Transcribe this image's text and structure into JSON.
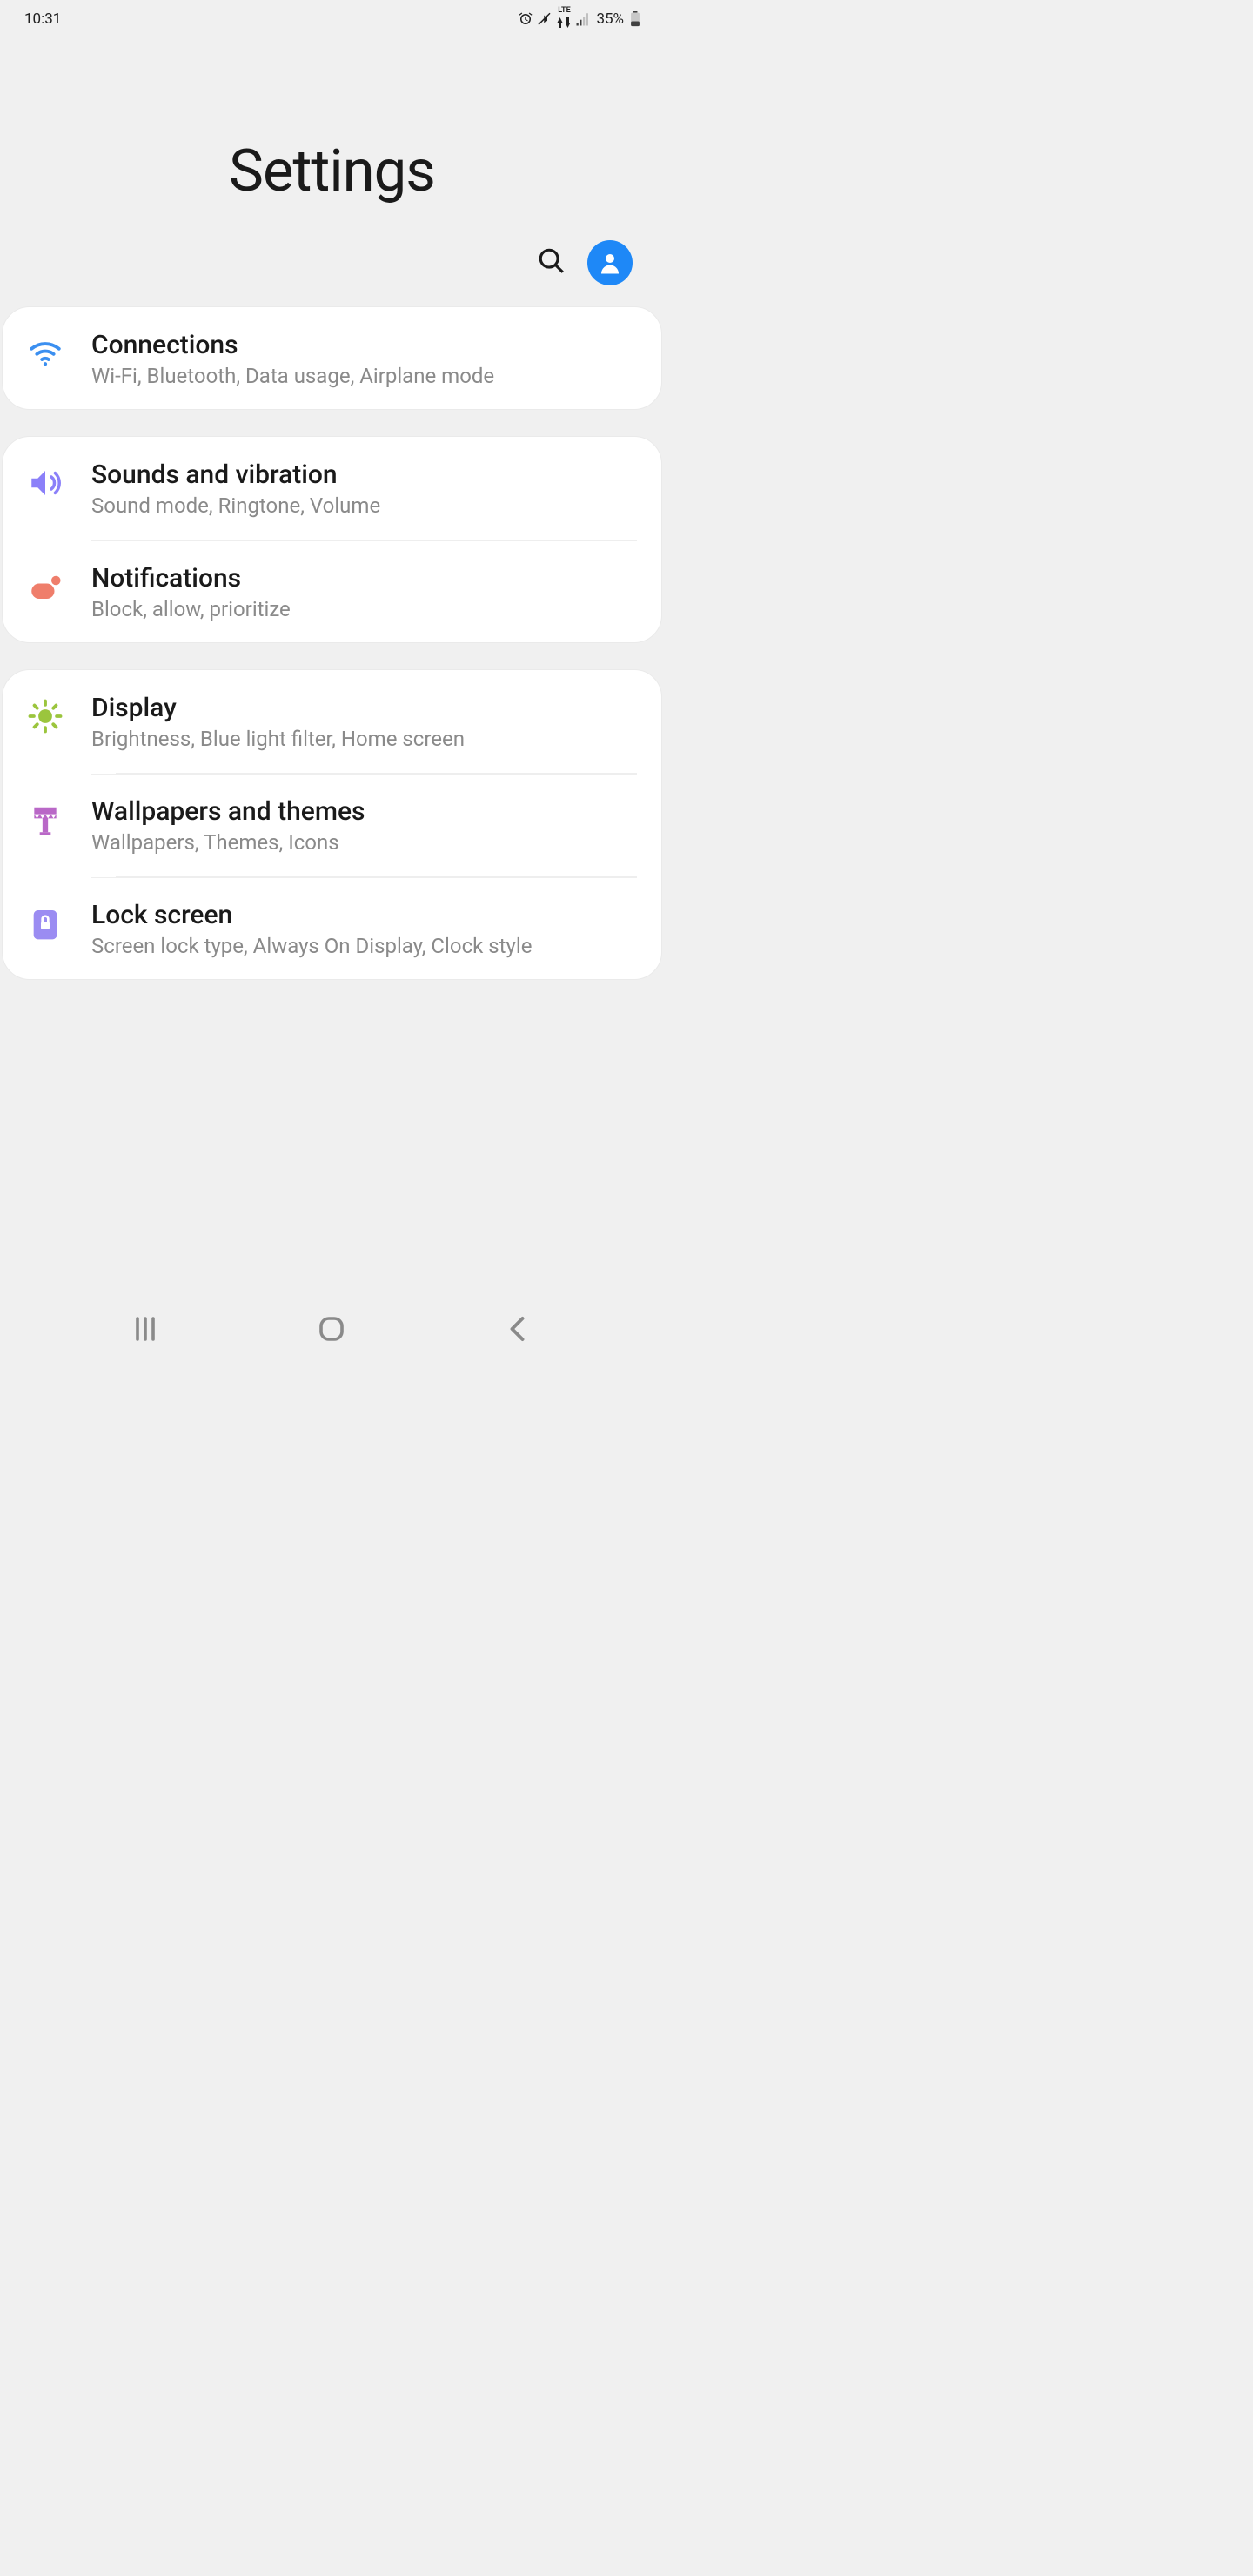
{
  "status": {
    "time": "10:31",
    "battery": "35%",
    "network_label": "LTE"
  },
  "hero": {
    "title": "Settings"
  },
  "groups": [
    {
      "rows": [
        {
          "icon": "wifi",
          "title": "Connections",
          "sub": "Wi-Fi, Bluetooth, Data usage, Airplane mode"
        }
      ]
    },
    {
      "rows": [
        {
          "icon": "sound",
          "title": "Sounds and vibration",
          "sub": "Sound mode, Ringtone, Volume"
        },
        {
          "icon": "notifications",
          "title": "Notifications",
          "sub": "Block, allow, prioritize"
        }
      ]
    },
    {
      "rows": [
        {
          "icon": "display",
          "title": "Display",
          "sub": "Brightness, Blue light filter, Home screen"
        },
        {
          "icon": "wallpaper",
          "title": "Wallpapers and themes",
          "sub": "Wallpapers, Themes, Icons"
        },
        {
          "icon": "lock",
          "title": "Lock screen",
          "sub": "Screen lock type, Always On Display, Clock style"
        }
      ]
    }
  ]
}
